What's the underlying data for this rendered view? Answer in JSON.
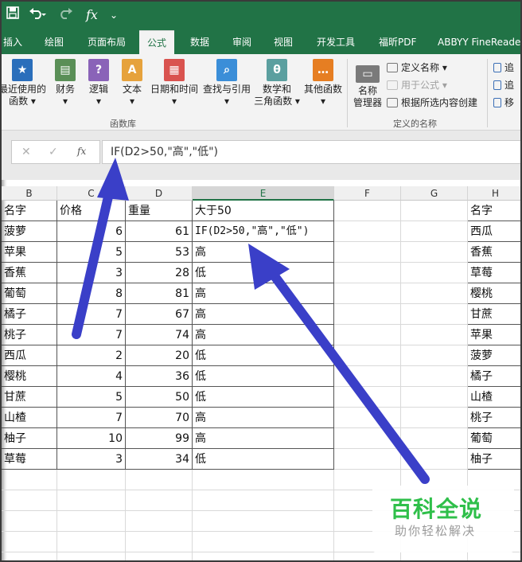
{
  "qat": {
    "save_icon": "save-icon",
    "undo_icon": "undo-icon",
    "redo_icon": "redo-icon",
    "fx_label": "fx",
    "more_icon": "customize-qat-icon"
  },
  "tabs": [
    "插入",
    "绘图",
    "页面布局",
    "公式",
    "数据",
    "审阅",
    "视图",
    "开发工具",
    "福昕PDF",
    "ABBYY FineReade"
  ],
  "ribbon": {
    "function_library": {
      "buttons": [
        {
          "label1": "最近使用的",
          "label2": "函数 ▾",
          "icon": "star-book-icon",
          "color": "#2a6ebb"
        },
        {
          "label1": "财务",
          "label2": "▾",
          "icon": "finance-book-icon",
          "color": "#5a8f57"
        },
        {
          "label1": "逻辑",
          "label2": "▾",
          "icon": "logic-book-icon",
          "color": "#8a63b8"
        },
        {
          "label1": "文本",
          "label2": "▾",
          "icon": "text-book-icon",
          "color": "#e6a23c"
        },
        {
          "label1": "日期和时间",
          "label2": "▾",
          "icon": "calendar-book-icon",
          "color": "#d9534f"
        },
        {
          "label1": "查找与引用",
          "label2": "▾",
          "icon": "lookup-book-icon",
          "color": "#3b8ed8"
        },
        {
          "label1": "数学和",
          "label2": "三角函数 ▾",
          "icon": "math-book-icon",
          "color": "#5b9f9f"
        },
        {
          "label1": "其他函数",
          "label2": "▾",
          "icon": "more-functions-icon",
          "color": "#e67e22"
        }
      ],
      "group_label": "函数库"
    },
    "defined_names": {
      "name_manager_label1": "名称",
      "name_manager_label2": "管理器",
      "define_name": "定义名称 ▾",
      "use_in_formula": "用于公式 ▾",
      "create_from_selection": "根据所选内容创建",
      "group_label": "定义的名称"
    },
    "formula_auditing": {
      "items": [
        "追",
        "追",
        "移"
      ]
    }
  },
  "formula_bar": {
    "cancel": "✕",
    "enter": "✓",
    "fx": "fx",
    "formula": "IF(D2>50,\"高\",\"低\")"
  },
  "columns": [
    "B",
    "C",
    "D",
    "E",
    "F",
    "G",
    "H"
  ],
  "headers": {
    "b": "名字",
    "c": "价格",
    "d": "重量",
    "e": "大于50",
    "h": "名字"
  },
  "rows": [
    {
      "b": "菠萝",
      "c": "6",
      "d": "61",
      "e": "IF(D2>50,\"高\",\"低\")",
      "h": "西瓜"
    },
    {
      "b": "苹果",
      "c": "5",
      "d": "53",
      "e": "高",
      "h": "香蕉"
    },
    {
      "b": "香蕉",
      "c": "3",
      "d": "28",
      "e": "低",
      "h": "草莓"
    },
    {
      "b": "葡萄",
      "c": "8",
      "d": "81",
      "e": "高",
      "h": "樱桃"
    },
    {
      "b": "橘子",
      "c": "7",
      "d": "67",
      "e": "高",
      "h": "甘蔗"
    },
    {
      "b": "桃子",
      "c": "7",
      "d": "74",
      "e": "高",
      "h": "苹果"
    },
    {
      "b": "西瓜",
      "c": "2",
      "d": "20",
      "e": "低",
      "h": "菠萝"
    },
    {
      "b": "樱桃",
      "c": "4",
      "d": "36",
      "e": "低",
      "h": "橘子"
    },
    {
      "b": "甘蔗",
      "c": "5",
      "d": "50",
      "e": "低",
      "h": "山楂"
    },
    {
      "b": "山楂",
      "c": "7",
      "d": "70",
      "e": "高",
      "h": "桃子"
    },
    {
      "b": "柚子",
      "c": "10",
      "d": "99",
      "e": "高",
      "h": "葡萄"
    },
    {
      "b": "草莓",
      "c": "3",
      "d": "34",
      "e": "低",
      "h": "柚子"
    }
  ],
  "arrow_color": "#3a3fc8",
  "accent": "#217346",
  "watermark": {
    "main": "百科全说",
    "sub": "助你轻松解决"
  }
}
